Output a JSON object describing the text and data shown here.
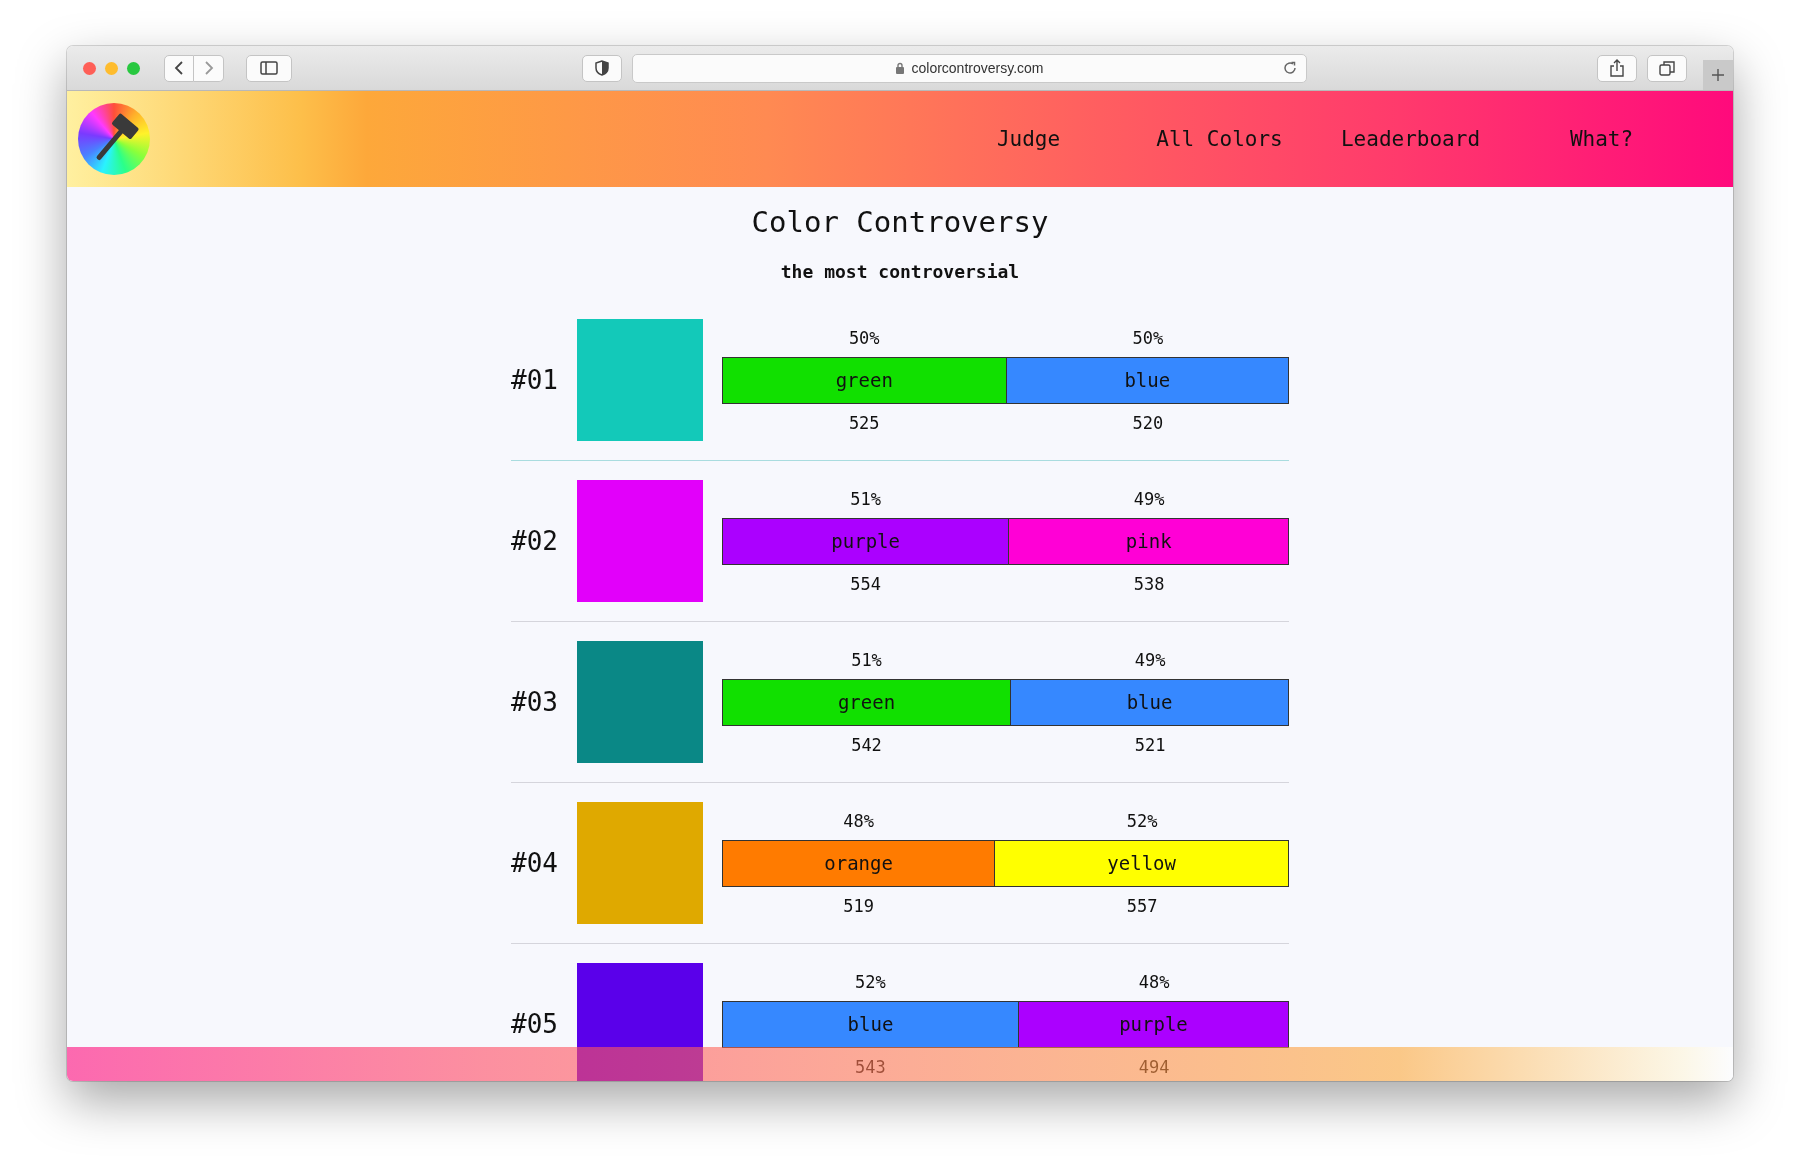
{
  "browser": {
    "url": "colorcontroversy.com"
  },
  "nav": [
    {
      "label": "Judge"
    },
    {
      "label": "All Colors"
    },
    {
      "label": "Leaderboard"
    },
    {
      "label": "What?"
    }
  ],
  "title": "Color Controversy",
  "subtitle": "the most controversial",
  "rows": [
    {
      "rank": "#01",
      "color": "#13c9b9",
      "level": 0.502,
      "left": {
        "percent": "50%",
        "name": "green",
        "count": "525",
        "color": "#11e000"
      },
      "right": {
        "percent": "50%",
        "name": "blue",
        "count": "520",
        "color": "#3688ff"
      }
    },
    {
      "rank": "#02",
      "color": "#e200fa",
      "level": 0.507,
      "left": {
        "percent": "51%",
        "name": "purple",
        "count": "554",
        "color": "#ab00ff"
      },
      "right": {
        "percent": "49%",
        "name": "pink",
        "count": "538",
        "color": "#ff00d6"
      }
    },
    {
      "rank": "#03",
      "color": "#0a8886",
      "level": 0.51,
      "left": {
        "percent": "51%",
        "name": "green",
        "count": "542",
        "color": "#11e000"
      },
      "right": {
        "percent": "49%",
        "name": "blue",
        "count": "521",
        "color": "#3688ff"
      }
    },
    {
      "rank": "#04",
      "color": "#dfa900",
      "level": 0.482,
      "left": {
        "percent": "48%",
        "name": "orange",
        "count": "519",
        "color": "#ff7b00"
      },
      "right": {
        "percent": "52%",
        "name": "yellow",
        "count": "557",
        "color": "#ffff00"
      }
    },
    {
      "rank": "#05",
      "color": "#5a00ea",
      "level": 0.524,
      "left": {
        "percent": "52%",
        "name": "blue",
        "count": "543",
        "color": "#3688ff"
      },
      "right": {
        "percent": "48%",
        "name": "purple",
        "count": "494",
        "color": "#ab00ff"
      }
    }
  ]
}
